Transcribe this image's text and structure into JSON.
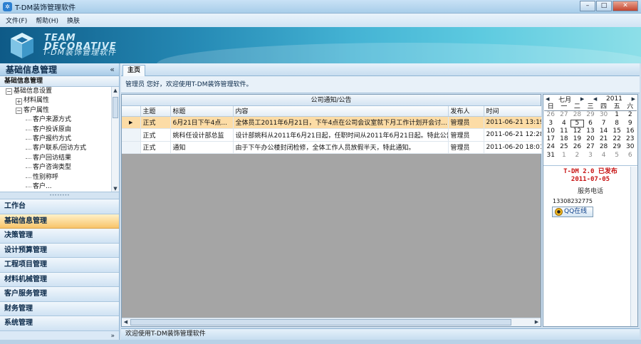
{
  "window": {
    "title": "T-DM装饰管理软件"
  },
  "menu": [
    "文件(F)",
    "帮助(H)",
    "换肤"
  ],
  "banner": {
    "line1": "TEAM",
    "line2": "DECORATIVE",
    "line3": "T-DM装饰管理软件"
  },
  "left": {
    "header": "基础信息管理",
    "collapse": "«",
    "subheader": "基础信息管理",
    "tree": [
      {
        "label": "基础信息设置",
        "level": 0,
        "expander": "−"
      },
      {
        "label": "材料属性",
        "level": 1,
        "expander": "+"
      },
      {
        "label": "客户属性",
        "level": 1,
        "expander": "−"
      },
      {
        "label": "客户来源方式",
        "level": 2
      },
      {
        "label": "客户投诉原由",
        "level": 2
      },
      {
        "label": "客户报约方式",
        "level": 2
      },
      {
        "label": "客户联系/回访方式",
        "level": 2
      },
      {
        "label": "客户回访结果",
        "level": 2
      },
      {
        "label": "客户咨询类型",
        "level": 2
      },
      {
        "label": "性别称呼",
        "level": 2
      },
      {
        "label": "客户...",
        "level": 2
      }
    ],
    "nav": [
      {
        "label": "工作台",
        "active": false
      },
      {
        "label": "基础信息管理",
        "active": true
      },
      {
        "label": "决策管理",
        "active": false
      },
      {
        "label": "设计预算管理",
        "active": false
      },
      {
        "label": "工程项目管理",
        "active": false
      },
      {
        "label": "材料机械管理",
        "active": false
      },
      {
        "label": "客户服务管理",
        "active": false
      },
      {
        "label": "财务管理",
        "active": false
      },
      {
        "label": "系统管理",
        "active": false
      }
    ],
    "footer": "»"
  },
  "main": {
    "tab": "主页",
    "welcome": "管理员 您好，欢迎使用T-DM装饰管理软件。",
    "notice_title": "公司通知/公告",
    "columns": [
      "主题",
      "标题",
      "内容",
      "发布人",
      "时间"
    ],
    "rows": [
      {
        "marker": "▶",
        "subject": "正式",
        "title": "6月21日下午4点...",
        "content": "全体员工2011年6月21日，下午4点在公司会议室就下月工作计划开会讨...",
        "publisher": "管理员",
        "time": "2011-06-21 13:19:",
        "selected": true
      },
      {
        "marker": "",
        "subject": "正式",
        "title": "姚科任设计部总监",
        "content": "设计部姚科从2011年6月21日起，任职时间从2011年6月21日起。特此公告。",
        "publisher": "管理员",
        "time": "2011-06-21 12:28:",
        "selected": false
      },
      {
        "marker": "",
        "subject": "正式",
        "title": "通知",
        "content": "由于下午办公楼封闭检修，全体工作人员放假半天，特此通知。",
        "publisher": "管理员",
        "time": "2011-06-20 18:01",
        "selected": false
      }
    ]
  },
  "calendar": {
    "month": "七月",
    "year": "2011",
    "dow": [
      "日",
      "一",
      "二",
      "三",
      "四",
      "五",
      "六"
    ],
    "days": [
      {
        "d": "26",
        "other": true
      },
      {
        "d": "27",
        "other": true
      },
      {
        "d": "28",
        "other": true
      },
      {
        "d": "29",
        "other": true
      },
      {
        "d": "30",
        "other": true
      },
      {
        "d": "1"
      },
      {
        "d": "2"
      },
      {
        "d": "3"
      },
      {
        "d": "4"
      },
      {
        "d": "5",
        "today": true
      },
      {
        "d": "6"
      },
      {
        "d": "7"
      },
      {
        "d": "8"
      },
      {
        "d": "9"
      },
      {
        "d": "10"
      },
      {
        "d": "11"
      },
      {
        "d": "12"
      },
      {
        "d": "13"
      },
      {
        "d": "14"
      },
      {
        "d": "15"
      },
      {
        "d": "16"
      },
      {
        "d": "17"
      },
      {
        "d": "18"
      },
      {
        "d": "19"
      },
      {
        "d": "20"
      },
      {
        "d": "21"
      },
      {
        "d": "22"
      },
      {
        "d": "23"
      },
      {
        "d": "24"
      },
      {
        "d": "25"
      },
      {
        "d": "26"
      },
      {
        "d": "27"
      },
      {
        "d": "28"
      },
      {
        "d": "29"
      },
      {
        "d": "30"
      },
      {
        "d": "31"
      },
      {
        "d": "1",
        "other": true
      },
      {
        "d": "2",
        "other": true
      },
      {
        "d": "3",
        "other": true
      },
      {
        "d": "4",
        "other": true
      },
      {
        "d": "5",
        "other": true
      },
      {
        "d": "6",
        "other": true
      }
    ]
  },
  "release": {
    "line1": "T-DM 2.0 已发布",
    "line2": "2011-07-05"
  },
  "contact": {
    "label": "服务电话",
    "phone": "13308232775",
    "qq": "QQ在线"
  },
  "status": "欢迎使用T-DM装饰管理软件",
  "colors": {
    "accent": "#f8c46a",
    "release": "#c81414",
    "grid_bg": "#a5a5a5"
  }
}
